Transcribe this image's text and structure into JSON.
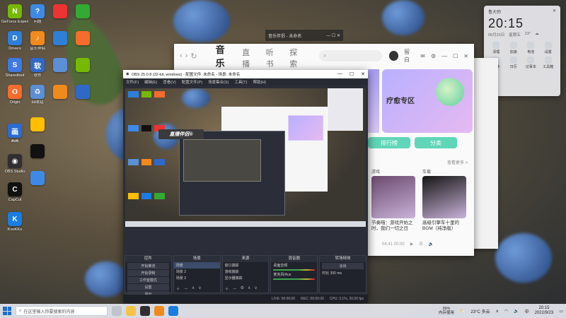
{
  "desktop": {
    "icons": [
      {
        "label": "GeForce Experience",
        "color": "#76b900",
        "glyph": "N"
      },
      {
        "label": "Drivers",
        "color": "#2f7fd9",
        "glyph": "D"
      },
      {
        "label": "Sharedtool",
        "color": "#3f7ae0",
        "glyph": "S"
      },
      {
        "label": "Origin",
        "color": "#f56c2d",
        "glyph": "O"
      },
      {
        "label": "画画",
        "color": "#2c6bd3",
        "glyph": "画"
      },
      {
        "label": "OBS Studio",
        "color": "#302e31",
        "glyph": "◉"
      },
      {
        "label": "CapCut",
        "color": "#111",
        "glyph": "C"
      },
      {
        "label": "KooKKo",
        "color": "#1a7de1",
        "glyph": "K"
      },
      {
        "label": "问题",
        "color": "#3d8ae6",
        "glyph": "?"
      },
      {
        "label": "音乐伴侣",
        "color": "#f08a1c",
        "glyph": "♪"
      },
      {
        "label": "软件",
        "color": "#2f69c8",
        "glyph": "软"
      },
      {
        "label": "回收站",
        "color": "#5b8fd6",
        "glyph": "♻"
      }
    ]
  },
  "bg_window": {
    "title": "音乐伴侣 - 未命名"
  },
  "music_app": {
    "tabs": [
      "音乐",
      "直播",
      "听书",
      "探索"
    ],
    "active_tab": "音乐",
    "search_placeholder": "",
    "user_name": "留白",
    "promo_title": "疗愈专区",
    "chips": [
      "排行榜",
      "分类"
    ],
    "more_label": "查看更多 >",
    "cards": [
      {
        "tag": "游戏",
        "desc": "节奏喵：游戏开始之时，我们一切之日",
        "color": "#6b4a6e"
      },
      {
        "tag": "车载",
        "desc": "高级引擎车十里的BGM（纯净版）",
        "color": "#151515"
      }
    ],
    "footer_text": "04:41 00:00"
  },
  "widget": {
    "title": "鲁大师",
    "time": "20:15",
    "date": "09月23日",
    "weekday": "星期五",
    "weather": "23°",
    "items": [
      "清理",
      "加速",
      "电池",
      "设置",
      "计算",
      "日历",
      "记事本",
      "工具箱"
    ]
  },
  "obs": {
    "title": "OBS 25.0.8 (32-bit, windows) - 配置文件: 未命名 - 场景: 未命名",
    "menu": [
      "文件(F)",
      "编辑(E)",
      "查看(V)",
      "配置文件(P)",
      "场景集合(S)",
      "工具(T)",
      "帮助(H)"
    ],
    "preview_logo": "直播伴侣®",
    "dock_titles": [
      "控件",
      "场景",
      "来源",
      "混音器",
      "转场特效"
    ],
    "controls": [
      "开始推流",
      "开始录制",
      "工作室模式",
      "设置",
      "退出"
    ],
    "scenes": [
      "场景",
      "场景 2",
      "场景 3"
    ],
    "sources": [
      "窗口捕获",
      "游戏捕获",
      "显示器捕获"
    ],
    "mixer": [
      "桌面音频",
      "麦克风/Aux"
    ],
    "transitions": {
      "type": "淡出",
      "duration_label": "时长",
      "duration": "300 ms"
    },
    "status": [
      "LIVE: 00:00:00",
      "REC: 00:00:00",
      "CPU: 3.1%, 30.00 fps"
    ]
  },
  "taskbar": {
    "search_placeholder": "在这里输入你要搜索的内容",
    "cpu_label": "36%",
    "cpu_sub": "内存使用",
    "weather": "23°C 多云",
    "lang": "中",
    "time": "20:15",
    "date": "2022/9/23"
  }
}
